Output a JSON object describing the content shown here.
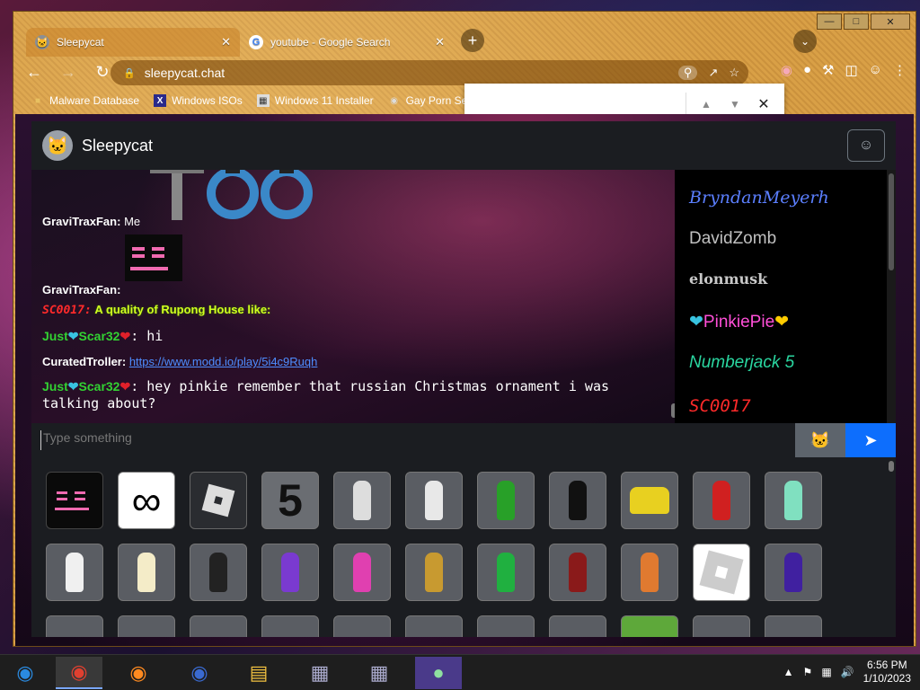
{
  "browser": {
    "tabs": [
      {
        "title": "Sleepycat",
        "active": true
      },
      {
        "title": "youtube - Google Search",
        "active": false
      }
    ],
    "url": "sleepycat.chat",
    "bookmarks": [
      "Malware Database",
      "Windows ISOs",
      "Windows 11 Installer",
      "Gay Porn Se"
    ]
  },
  "app": {
    "title": "Sleepycat",
    "input_placeholder": "Type something"
  },
  "messages": [
    {
      "user": "GraviTraxFan:",
      "text": "Me"
    },
    {
      "user": "GraviTraxFan:",
      "text": ""
    },
    {
      "user": "SC0017:",
      "text": "A quality of Rupong House like:"
    },
    {
      "user": "Just",
      "user2": "Scar32",
      "text": ": hi"
    },
    {
      "user": "CuratedTroller:",
      "link": "https://www.modd.io/play/5i4c9Ruqh"
    },
    {
      "user": "Just",
      "user2": "Scar32",
      "text": ": hey pinkie remember that russian Christmas ornament i was talking about?"
    }
  ],
  "users": [
    {
      "name": "BryndanMeyerh",
      "color": "#5b7fff"
    },
    {
      "name": "DavidZomb",
      "color": "#c0c0c0"
    },
    {
      "name": "elonmusk",
      "color": "#c8c8c8"
    },
    {
      "name": "PinkiePie",
      "color": "#ff4fd8"
    },
    {
      "name": "Numberjack 5",
      "color": "#2ad6a0"
    },
    {
      "name": "SC0017",
      "color": "#ff2a2a"
    }
  ],
  "emotes": {
    "row1": [
      "face",
      "infinity",
      "roblox-logo",
      "five",
      "char-gray1",
      "char-gray2",
      "char-green",
      "char-black",
      "char-yellow",
      "char-red",
      "char-mint"
    ],
    "row2": [
      "char-white1",
      "char-cream",
      "char-dark",
      "char-purple",
      "char-pink",
      "char-gold",
      "char-green2",
      "char-maroon",
      "char-santa",
      "roblox-logo-white",
      "char-violet"
    ],
    "row3_colors": [
      "#5a5d63",
      "#5a5d63",
      "#5a5d63",
      "#5a5d63",
      "#5a5d63",
      "#5a5d63",
      "#5a5d63",
      "#5a5d63",
      "#5ea83a",
      "#5a5d63",
      "#5a5d63"
    ]
  },
  "taskbar": {
    "time": "6:56 PM",
    "date": "1/10/2023"
  },
  "colors": {
    "accent": "#0d6efd",
    "header": "#1b1d21",
    "link": "#4e8dff"
  }
}
